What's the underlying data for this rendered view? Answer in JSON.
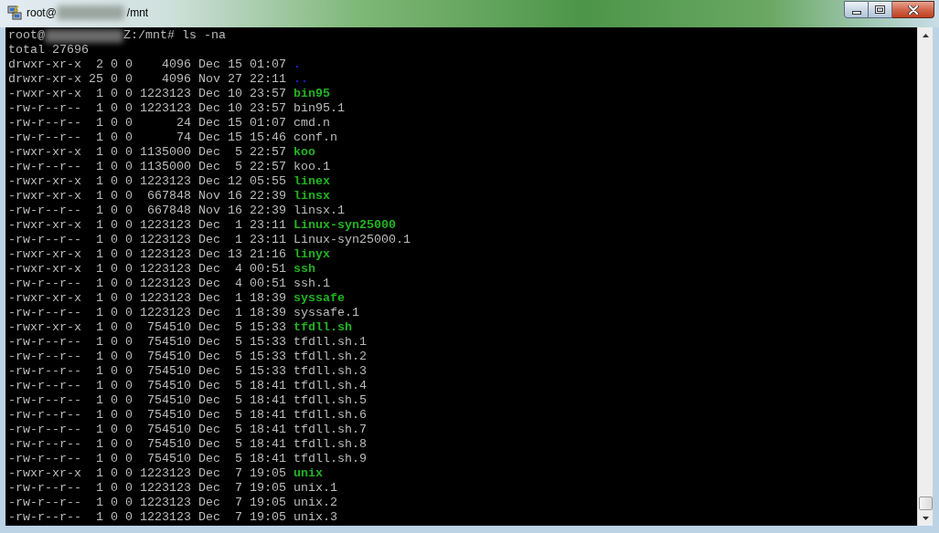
{
  "window": {
    "title_user": "root@",
    "title_path": "/mnt"
  },
  "terminal": {
    "prompt": {
      "user": "root@",
      "command": "Z:/mnt# ls -na"
    },
    "total": "total 27696",
    "entries": [
      {
        "kind": "directory",
        "info": "drwxr-xr-x  2 0 0    4096 Dec 15 01:07",
        "name": "."
      },
      {
        "kind": "directory",
        "info": "drwxr-xr-x 25 0 0    4096 Nov 27 22:11",
        "name": ".."
      },
      {
        "kind": "executable",
        "info": "-rwxr-xr-x  1 0 0 1223123 Dec 10 23:57",
        "name": "bin95"
      },
      {
        "kind": "file",
        "info": "-rw-r--r--  1 0 0 1223123 Dec 10 23:57",
        "name": "bin95.1"
      },
      {
        "kind": "file",
        "info": "-rw-r--r--  1 0 0      24 Dec 15 01:07",
        "name": "cmd.n"
      },
      {
        "kind": "file",
        "info": "-rw-r--r--  1 0 0      74 Dec 15 15:46",
        "name": "conf.n"
      },
      {
        "kind": "executable",
        "info": "-rwxr-xr-x  1 0 0 1135000 Dec  5 22:57",
        "name": "koo"
      },
      {
        "kind": "file",
        "info": "-rw-r--r--  1 0 0 1135000 Dec  5 22:57",
        "name": "koo.1"
      },
      {
        "kind": "executable",
        "info": "-rwxr-xr-x  1 0 0 1223123 Dec 12 05:55",
        "name": "linex"
      },
      {
        "kind": "executable",
        "info": "-rwxr-xr-x  1 0 0  667848 Nov 16 22:39",
        "name": "linsx"
      },
      {
        "kind": "file",
        "info": "-rw-r--r--  1 0 0  667848 Nov 16 22:39",
        "name": "linsx.1"
      },
      {
        "kind": "executable",
        "info": "-rwxr-xr-x  1 0 0 1223123 Dec  1 23:11",
        "name": "Linux-syn25000"
      },
      {
        "kind": "file",
        "info": "-rw-r--r--  1 0 0 1223123 Dec  1 23:11",
        "name": "Linux-syn25000.1"
      },
      {
        "kind": "executable",
        "info": "-rwxr-xr-x  1 0 0 1223123 Dec 13 21:16",
        "name": "linyx"
      },
      {
        "kind": "executable",
        "info": "-rwxr-xr-x  1 0 0 1223123 Dec  4 00:51",
        "name": "ssh"
      },
      {
        "kind": "file",
        "info": "-rw-r--r--  1 0 0 1223123 Dec  4 00:51",
        "name": "ssh.1"
      },
      {
        "kind": "executable",
        "info": "-rwxr-xr-x  1 0 0 1223123 Dec  1 18:39",
        "name": "syssafe"
      },
      {
        "kind": "file",
        "info": "-rw-r--r--  1 0 0 1223123 Dec  1 18:39",
        "name": "syssafe.1"
      },
      {
        "kind": "executable",
        "info": "-rwxr-xr-x  1 0 0  754510 Dec  5 15:33",
        "name": "tfdll.sh"
      },
      {
        "kind": "file",
        "info": "-rw-r--r--  1 0 0  754510 Dec  5 15:33",
        "name": "tfdll.sh.1"
      },
      {
        "kind": "file",
        "info": "-rw-r--r--  1 0 0  754510 Dec  5 15:33",
        "name": "tfdll.sh.2"
      },
      {
        "kind": "file",
        "info": "-rw-r--r--  1 0 0  754510 Dec  5 15:33",
        "name": "tfdll.sh.3"
      },
      {
        "kind": "file",
        "info": "-rw-r--r--  1 0 0  754510 Dec  5 18:41",
        "name": "tfdll.sh.4"
      },
      {
        "kind": "file",
        "info": "-rw-r--r--  1 0 0  754510 Dec  5 18:41",
        "name": "tfdll.sh.5"
      },
      {
        "kind": "file",
        "info": "-rw-r--r--  1 0 0  754510 Dec  5 18:41",
        "name": "tfdll.sh.6"
      },
      {
        "kind": "file",
        "info": "-rw-r--r--  1 0 0  754510 Dec  5 18:41",
        "name": "tfdll.sh.7"
      },
      {
        "kind": "file",
        "info": "-rw-r--r--  1 0 0  754510 Dec  5 18:41",
        "name": "tfdll.sh.8"
      },
      {
        "kind": "file",
        "info": "-rw-r--r--  1 0 0  754510 Dec  5 18:41",
        "name": "tfdll.sh.9"
      },
      {
        "kind": "executable",
        "info": "-rwxr-xr-x  1 0 0 1223123 Dec  7 19:05",
        "name": "unix"
      },
      {
        "kind": "file",
        "info": "-rw-r--r--  1 0 0 1223123 Dec  7 19:05",
        "name": "unix.1"
      },
      {
        "kind": "file",
        "info": "-rw-r--r--  1 0 0 1223123 Dec  7 19:05",
        "name": "unix.2"
      },
      {
        "kind": "file",
        "info": "-rw-r--r--  1 0 0 1223123 Dec  7 19:05",
        "name": "unix.3"
      }
    ]
  }
}
